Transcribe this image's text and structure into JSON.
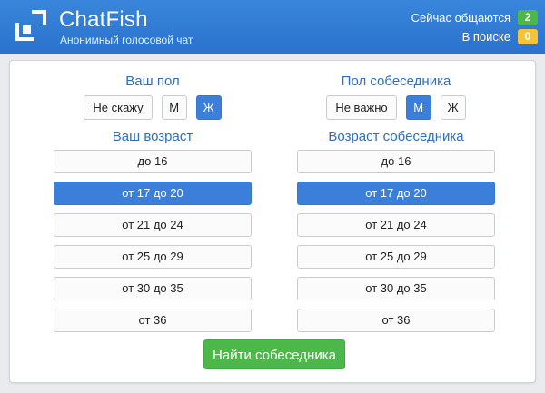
{
  "header": {
    "title": "ChatFish",
    "subtitle": "Анонимный голосовой чат",
    "stats": [
      {
        "label": "Сейчас общаются",
        "value": "2",
        "color": "#4cb84a"
      },
      {
        "label": "В поиске",
        "value": "0",
        "color": "#f4c33a"
      }
    ]
  },
  "my": {
    "gender_title": "Ваш пол",
    "gender_options": [
      {
        "label": "Не скажу",
        "selected": false
      },
      {
        "label": "М",
        "selected": false
      },
      {
        "label": "Ж",
        "selected": true
      }
    ],
    "age_title": "Ваш возраст",
    "age_options": [
      {
        "label": "до 16",
        "selected": false
      },
      {
        "label": "от 17 до 20",
        "selected": true
      },
      {
        "label": "от 21 до 24",
        "selected": false
      },
      {
        "label": "от 25 до 29",
        "selected": false
      },
      {
        "label": "от 30 до 35",
        "selected": false
      },
      {
        "label": "от 36",
        "selected": false
      }
    ]
  },
  "partner": {
    "gender_title": "Пол собеседника",
    "gender_options": [
      {
        "label": "Не важно",
        "selected": false
      },
      {
        "label": "М",
        "selected": true
      },
      {
        "label": "Ж",
        "selected": false
      }
    ],
    "age_title": "Возраст собеседника",
    "age_options": [
      {
        "label": "до 16",
        "selected": false
      },
      {
        "label": "от 17 до 20",
        "selected": true
      },
      {
        "label": "от 21 до 24",
        "selected": false
      },
      {
        "label": "от 25 до 29",
        "selected": false
      },
      {
        "label": "от 30 до 35",
        "selected": false
      },
      {
        "label": "от 36",
        "selected": false
      }
    ]
  },
  "find_button": "Найти собеседника",
  "colors": {
    "header": "#2e7bd6",
    "accent": "#3b7fdb",
    "title_text": "#2f6fb8",
    "success": "#4cb84a"
  }
}
